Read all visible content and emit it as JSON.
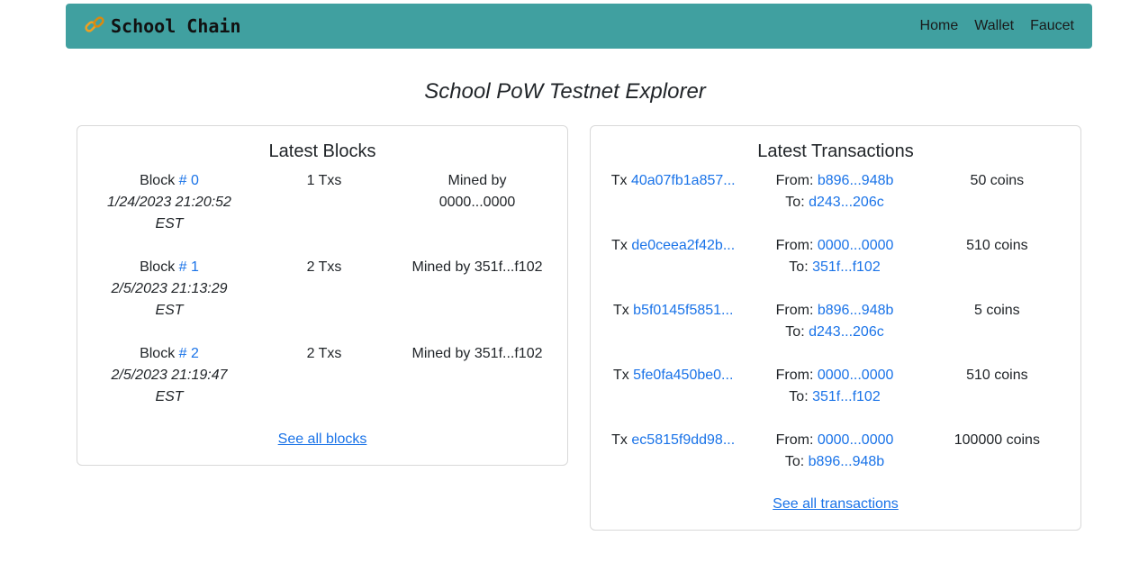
{
  "navbar": {
    "brand": "School Chain",
    "brand_icon": "link-icon",
    "brand_icon_color": "#f0a020",
    "background": "#40a0a0",
    "links": [
      "Home",
      "Wallet",
      "Faucet"
    ]
  },
  "page_title": "School PoW Testnet Explorer",
  "blocks": {
    "title": "Latest Blocks",
    "items": [
      {
        "label": "Block",
        "number": "# 0",
        "date": "1/24/2023 21:20:52",
        "tz": "EST",
        "txs": "1 Txs",
        "mined_prefix": "Mined by",
        "miner": "0000...0000"
      },
      {
        "label": "Block",
        "number": "# 1",
        "date": "2/5/2023 21:13:29",
        "tz": "EST",
        "txs": "2 Txs",
        "mined_prefix": "Mined by",
        "miner": "351f...f102"
      },
      {
        "label": "Block",
        "number": "# 2",
        "date": "2/5/2023 21:19:47",
        "tz": "EST",
        "txs": "2 Txs",
        "mined_prefix": "Mined by",
        "miner": "351f...f102"
      }
    ],
    "see_all": "See all blocks"
  },
  "transactions": {
    "title": "Latest Transactions",
    "items": [
      {
        "label": "Tx",
        "hash": "40a07fb1a857...",
        "from_label": "From:",
        "from": "b896...948b",
        "to_label": "To:",
        "to": "d243...206c",
        "amount": "50 coins"
      },
      {
        "label": "Tx",
        "hash": "de0ceea2f42b...",
        "from_label": "From:",
        "from": "0000...0000",
        "to_label": "To:",
        "to": "351f...f102",
        "amount": "510 coins"
      },
      {
        "label": "Tx",
        "hash": "b5f0145f5851...",
        "from_label": "From:",
        "from": "b896...948b",
        "to_label": "To:",
        "to": "d243...206c",
        "amount": "5 coins"
      },
      {
        "label": "Tx",
        "hash": "5fe0fa450be0...",
        "from_label": "From:",
        "from": "0000...0000",
        "to_label": "To:",
        "to": "351f...f102",
        "amount": "510 coins"
      },
      {
        "label": "Tx",
        "hash": "ec5815f9dd98...",
        "from_label": "From:",
        "from": "0000...0000",
        "to_label": "To:",
        "to": "b896...948b",
        "amount": "100000 coins"
      }
    ],
    "see_all": "See all transactions"
  },
  "colors": {
    "link": "#1a73e8",
    "text": "#212529"
  }
}
